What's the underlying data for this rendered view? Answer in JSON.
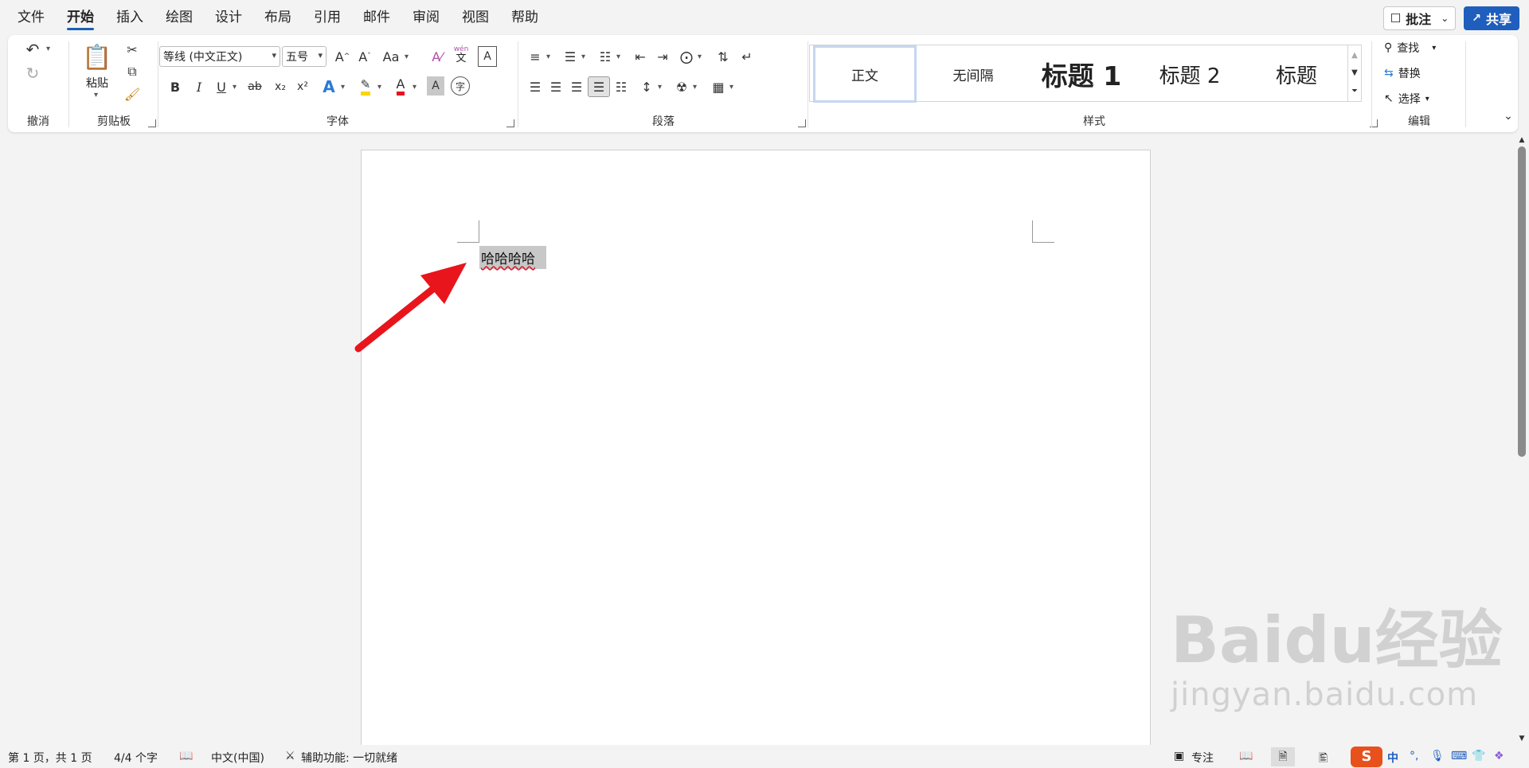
{
  "menu": {
    "tabs": [
      "文件",
      "开始",
      "插入",
      "绘图",
      "设计",
      "布局",
      "引用",
      "邮件",
      "审阅",
      "视图",
      "帮助"
    ],
    "active_index": 1,
    "comment_label": "批注",
    "share_label": "共享"
  },
  "ribbon": {
    "groups": {
      "undo": "撤消",
      "clipboard": "剪贴板",
      "font": "字体",
      "paragraph": "段落",
      "styles": "样式",
      "editing": "编辑"
    },
    "paste_label": "粘贴",
    "font_name": "等线 (中文正文)",
    "font_size": "五号",
    "font_size_grow": "A^",
    "font_case": "Aa",
    "phonetic_top": "wén",
    "phonetic_bottom": "文",
    "bold": "B",
    "italic": "I",
    "underline": "U",
    "strike": "ab",
    "subscript": "x₂",
    "superscript": "x²",
    "font_color": "A",
    "char_shading": "A",
    "enclose_char": "字",
    "styles": [
      "正文",
      "无间隔",
      "标题 1",
      "标题 2",
      "标题"
    ],
    "find_label": "查找",
    "replace_label": "替换",
    "select_label": "选择"
  },
  "document": {
    "text": "哈哈哈哈"
  },
  "status": {
    "page": "第 1 页，共 1 页",
    "words": "4/4 个字",
    "language": "中文(中国)",
    "accessibility": "辅助功能: 一切就绪",
    "focus": "专注",
    "ime_lang": "中"
  },
  "watermark": {
    "brand": "Baidu经验",
    "url": "jingyan.baidu.com"
  },
  "colors": {
    "accent": "#1f5ebd",
    "highlight": "#ffd400",
    "font_color": "#e81123",
    "arrow": "#e8151c"
  }
}
